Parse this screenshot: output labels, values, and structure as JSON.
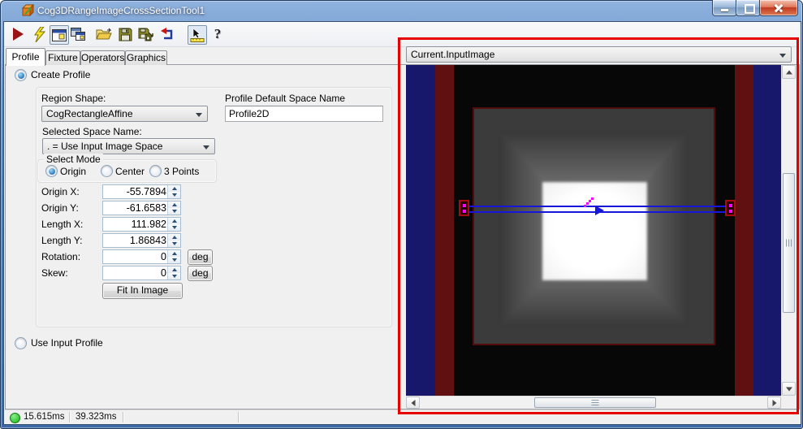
{
  "window": {
    "title": "Cog3DRangeImageCrossSectionTool1",
    "app_icon": "orange-cube-tool-icon",
    "controls": [
      "minimize",
      "maximize",
      "close"
    ]
  },
  "toolbar": {
    "icon_names": [
      "run-icon",
      "electric-run-icon",
      "show-image-control-icon",
      "float-window-icon",
      "open-file-icon",
      "save-icon",
      "save-as-icon",
      "reset-icon",
      "pointer-ruler-icon",
      "help-icon"
    ],
    "help_glyph": "?"
  },
  "tabs": {
    "items": [
      {
        "label": "Profile",
        "active": true
      },
      {
        "label": "Fixture",
        "active": false
      },
      {
        "label": "Operators",
        "active": false
      },
      {
        "label": "Graphics",
        "active": false
      }
    ]
  },
  "profile": {
    "create_profile_label": "Create Profile",
    "region_shape_label": "Region Shape:",
    "region_shape_value": "CogRectangleAffine",
    "default_space_label": "Profile Default Space Name",
    "default_space_value": "Profile2D",
    "selected_space_label": "Selected Space Name:",
    "selected_space_value": ". = Use Input Image Space",
    "select_mode_label": "Select Mode",
    "modes": [
      {
        "label": "Origin",
        "selected": true
      },
      {
        "label": "Center",
        "selected": false
      },
      {
        "label": "3 Points",
        "selected": false
      }
    ],
    "rows": [
      {
        "label": "Origin X:",
        "value": "-55.7894"
      },
      {
        "label": "Origin Y:",
        "value": "-61.6583"
      },
      {
        "label": "Length X:",
        "value": "111.982"
      },
      {
        "label": "Length Y:",
        "value": "1.86843"
      },
      {
        "label": "Rotation:",
        "value": "0",
        "unit": "deg"
      },
      {
        "label": "Skew:",
        "value": "0",
        "unit": "deg"
      }
    ],
    "fit_in_image_label": "Fit In Image",
    "use_input_profile_label": "Use Input Profile"
  },
  "display": {
    "source_value": "Current.InputImage"
  },
  "status_bar": {
    "time1": "15.615ms",
    "time2": "39.323ms"
  },
  "colors": {
    "highlight": "#e60000",
    "stripe_blue": "#17176b",
    "stripe_red": "#601010",
    "overlay_blue": "#1616dd",
    "handle_magenta": "#ff00ff",
    "titlebar_blue": "#4576b4",
    "status_green": "#19b419"
  }
}
